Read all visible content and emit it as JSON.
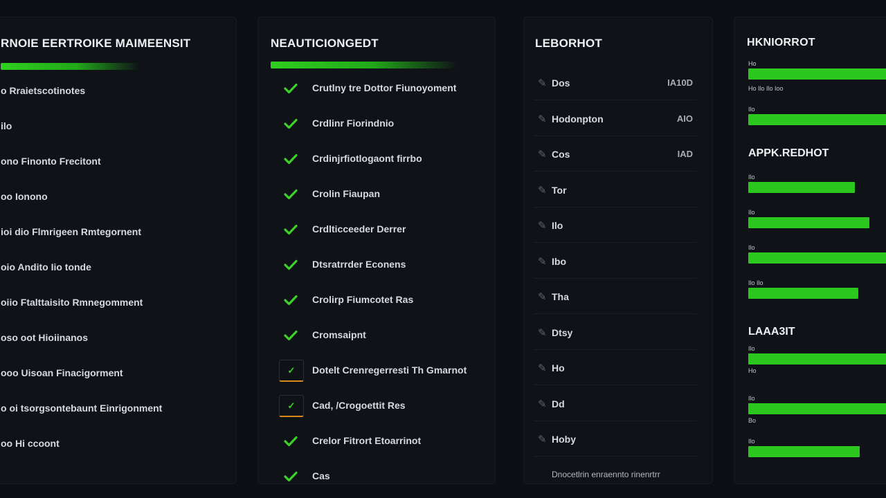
{
  "colors": {
    "accent": "#2cc71e",
    "background": "#0b0e12",
    "panel": "#0f1318",
    "warning": "#d98a1b"
  },
  "panel1": {
    "title": "RNOIE EERTROIKE MAIMEENSIT",
    "items": [
      "o Rraietscotinotes",
      "ilo",
      "ono Finonto Frecitont",
      "oo Ionono",
      "ioi dio Flmrigeen Rmtegornent",
      "oio Andito Iio tonde",
      "oiio Ftalttaisito Rmnegomment",
      "oso oot Hioiinanos",
      "ooo Uisoan Finacigorment",
      "o oi tsorgsontebaunt Einrigonment",
      "oo Hi ccoont"
    ]
  },
  "panel2": {
    "title": "NEAUTICIONGEDT",
    "items": [
      {
        "icon": "check-icon",
        "label": "Crutlny tre Dottor Fiunoyoment"
      },
      {
        "icon": "check-icon",
        "label": "Crdlinr Fiorindnio"
      },
      {
        "icon": "check-icon",
        "label": "Crdinjrfiotlogaont firrbo"
      },
      {
        "icon": "check-icon",
        "label": "Crolin Fiaupan"
      },
      {
        "icon": "check-icon",
        "label": "Crdlticceeder Derrer"
      },
      {
        "icon": "check-icon",
        "label": "Dtsratrrder Econens"
      },
      {
        "icon": "check-icon",
        "label": "Crolirp Fiumcotet Ras"
      },
      {
        "icon": "check-icon",
        "label": "Cromsaipnt"
      },
      {
        "icon": "warning-icon",
        "label": "Dotelt Crenregerresti Th Gmarnot"
      },
      {
        "icon": "warning-icon",
        "label": "Cad, /Crogoettit Res"
      },
      {
        "icon": "check-icon",
        "label": "Crelor Fitrort Etoarrinot"
      },
      {
        "icon": "check-icon",
        "label": "Cas"
      }
    ]
  },
  "panel3": {
    "title": "LEBORHOT",
    "rows": [
      {
        "name": "Dos",
        "value": "IA10D"
      },
      {
        "name": "Hodonpton",
        "value": "AIO"
      },
      {
        "name": "Cos",
        "value": "IAD"
      },
      {
        "name": "Tor",
        "value": ""
      },
      {
        "name": "Ilo",
        "value": ""
      },
      {
        "name": "Ibo",
        "value": ""
      },
      {
        "name": "Tha",
        "value": ""
      },
      {
        "name": "Dtsy",
        "value": ""
      },
      {
        "name": "Ho",
        "value": ""
      },
      {
        "name": "Dd",
        "value": ""
      },
      {
        "name": "Hoby",
        "value": ""
      }
    ],
    "footer": "Dnocetlrin enraennto rinenrtrr"
  },
  "panel4": {
    "title": "HKNIORROT",
    "section1": {
      "bars": [
        {
          "label": "Ho",
          "value": 100
        },
        {
          "label": "Ho Ilo Ilo Ioo",
          "value": 0
        },
        {
          "label": "Ilo",
          "value": 100
        }
      ]
    },
    "section2": {
      "title": "APPK.REDHOT",
      "bars": [
        {
          "label": "Ilo",
          "value": 67
        },
        {
          "label": "Ilo",
          "value": 76
        },
        {
          "label": "Ilo",
          "value": 100
        },
        {
          "label": "Ilo Ilo",
          "value": 69
        }
      ]
    },
    "section3": {
      "title": "LAAA3IT",
      "bars": [
        {
          "label": "Ilo",
          "value": 100,
          "sublabel": "Ho"
        },
        {
          "label": "Ilo",
          "value": 100,
          "sublabel": "Bo"
        },
        {
          "label": "Ilo",
          "value": 70,
          "sublabel": ""
        }
      ]
    }
  }
}
